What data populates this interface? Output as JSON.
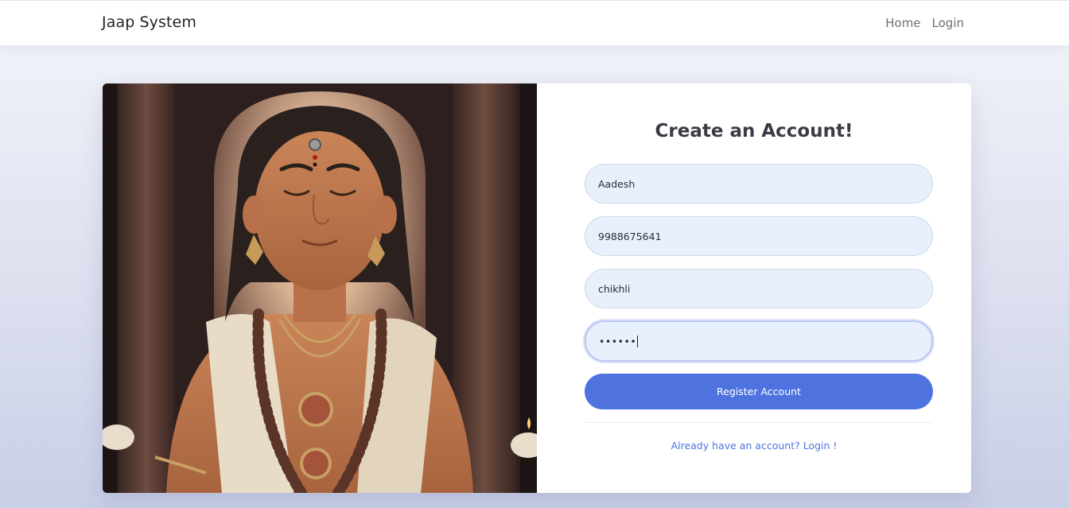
{
  "navbar": {
    "brand": "Jaap System",
    "links": [
      {
        "label": "Home"
      },
      {
        "label": "Login"
      }
    ]
  },
  "hero": {
    "image": "meditating-sage-illustration"
  },
  "form": {
    "title": "Create an Account!",
    "name_value": "Aadesh",
    "phone_value": "9988675641",
    "city_value": "chikhli",
    "password_masked": "••••••",
    "register_label": "Register Account",
    "login_link": "Already have an account? Login !"
  },
  "colors": {
    "primary": "#4e73df",
    "input_bg": "#e8f0fe",
    "title": "#3a3b45"
  }
}
